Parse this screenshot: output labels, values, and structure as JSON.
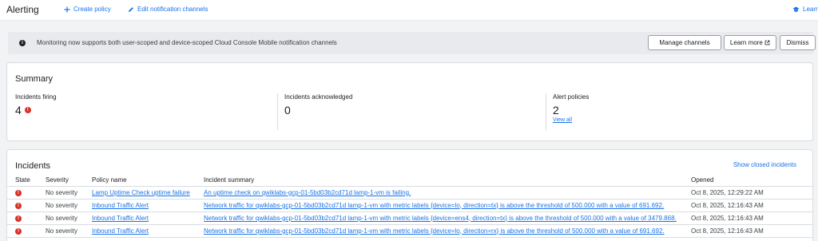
{
  "header": {
    "title": "Alerting",
    "create_policy": "Create policy",
    "edit_channels": "Edit notification channels",
    "learn": "Learn"
  },
  "banner": {
    "message": "Monitoring now supports both user-scoped and device-scoped Cloud Console Mobile notification channels",
    "manage_channels": "Manage channels",
    "learn_more": "Learn more",
    "dismiss": "Dismiss"
  },
  "summary": {
    "title": "Summary",
    "incidents_firing": {
      "label": "Incidents firing",
      "value": "4"
    },
    "incidents_acknowledged": {
      "label": "Incidents acknowledged",
      "value": "0"
    },
    "alert_policies": {
      "label": "Alert policies",
      "value": "2",
      "link": "View all"
    }
  },
  "incidents": {
    "title": "Incidents",
    "show_closed": "Show closed incidents",
    "columns": [
      "State",
      "Severity",
      "Policy name",
      "Incident summary",
      "Opened"
    ],
    "rows": [
      {
        "state_icon": "error-icon",
        "severity": "No severity",
        "policy": "Lamp Uptime Check uptime failure",
        "summary": "An uptime check on qwiklabs-gcp-01-5bd03b2cd71d lamp-1-vm is failing.",
        "opened": "Oct 8, 2025, 12:29:22 AM"
      },
      {
        "state_icon": "error-icon",
        "severity": "No severity",
        "policy": "Inbound Traffic Alert",
        "summary": "Network traffic for qwiklabs-gcp-01-5bd03b2cd71d lamp-1-vm with metric labels {device=lo, direction=tx} is above the threshold of 500.000 with a value of 691.692.",
        "opened": "Oct 8, 2025, 12:16:43 AM"
      },
      {
        "state_icon": "error-icon",
        "severity": "No severity",
        "policy": "Inbound Traffic Alert",
        "summary": "Network traffic for qwiklabs-gcp-01-5bd03b2cd71d lamp-1-vm with metric labels {device=ens4, direction=tx} is above the threshold of 500.000 with a value of 3479.868.",
        "opened": "Oct 8, 2025, 12:16:43 AM"
      },
      {
        "state_icon": "error-icon",
        "severity": "No severity",
        "policy": "Inbound Traffic Alert",
        "summary": "Network traffic for qwiklabs-gcp-01-5bd03b2cd71d lamp-1-vm with metric labels {device=lo, direction=rx} is above the threshold of 500.000 with a value of 691.692.",
        "opened": "Oct 8, 2025, 12:16:43 AM"
      }
    ]
  },
  "colors": {
    "accent": "#1a73e8",
    "error": "#d93025"
  }
}
